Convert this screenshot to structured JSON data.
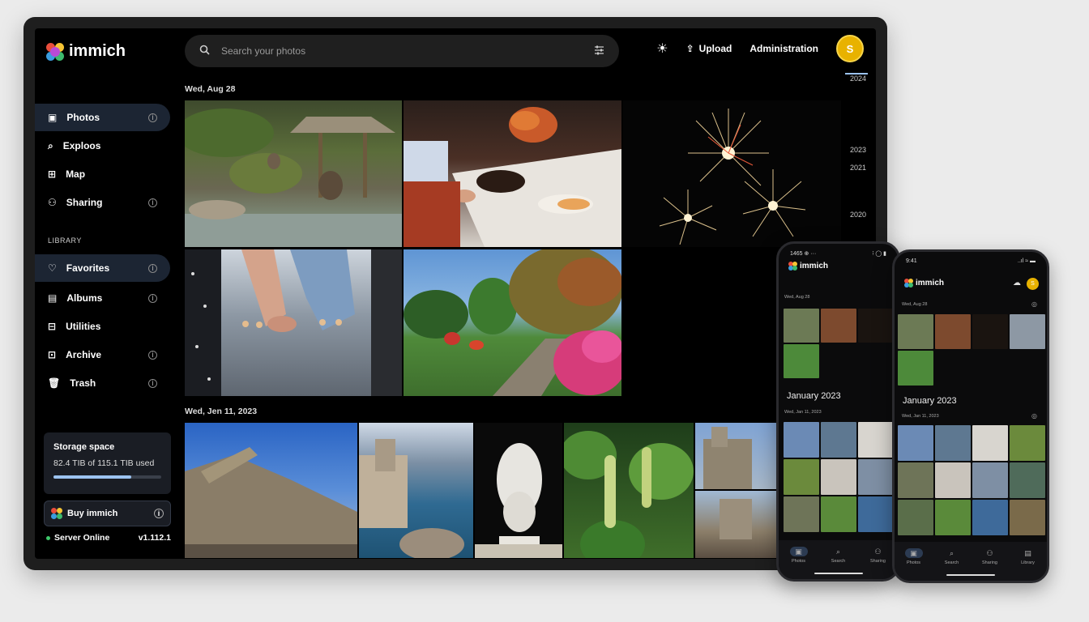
{
  "app": {
    "name": "immich"
  },
  "search": {
    "placeholder": "Search your photos"
  },
  "header": {
    "upload": "Upload",
    "admin": "Administration",
    "avatar": "S"
  },
  "sidebar": {
    "items": [
      {
        "label": "Photos"
      },
      {
        "label": "Exploos"
      },
      {
        "label": "Map"
      },
      {
        "label": "Sharing"
      }
    ],
    "library_heading": "LIBRARY",
    "library": [
      {
        "label": "Favorites"
      },
      {
        "label": "Albums"
      },
      {
        "label": "Utilities"
      },
      {
        "label": "Archive"
      },
      {
        "label": "Trash"
      }
    ],
    "storage": {
      "title": "Storage space",
      "used": "82.4 TIB of 115.1 TIB used",
      "fraction": 0.72
    },
    "buy": "Buy immich",
    "server": {
      "status": "Server Online",
      "version": "v1.112.1"
    }
  },
  "groups": [
    {
      "date": "Wed, Aug 28"
    },
    {
      "date": "Wed, Jen 11, 2023"
    }
  ],
  "timeline": [
    "2024",
    "2023",
    "2021",
    "2020"
  ],
  "phone1": {
    "status_left": "1465 ⊕ ···",
    "status_right": "⁝ ◯ ▮",
    "app": "immich",
    "date1": "Wed, Aug 28",
    "month": "January 2023",
    "date2": "Wed, Jan 11, 2023",
    "nav": [
      "Photos",
      "Search",
      "Sharing"
    ]
  },
  "phone2": {
    "status_left": "9:41",
    "status_right": "..ıl ≈ ▬",
    "app": "immich",
    "avatar": "S",
    "date1": "Wed, Aug 28",
    "month": "January 2023",
    "date2": "Wed, Jan 11, 2023",
    "nav": [
      "Photos",
      "Search",
      "Sharing",
      "Library"
    ]
  },
  "colors": {
    "accent": "#9cc3f0",
    "active_bg": "#1c2533",
    "avatar": "#e8b200",
    "online": "#3ec86b"
  }
}
